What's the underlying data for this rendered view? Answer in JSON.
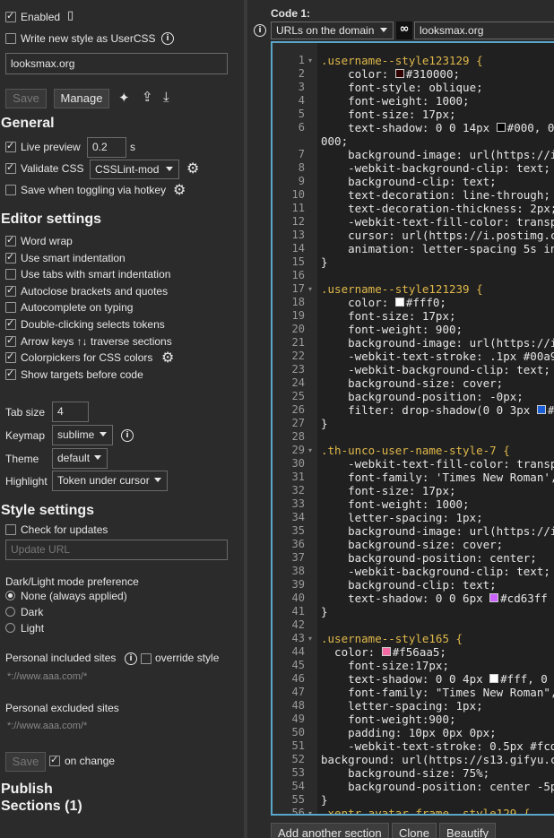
{
  "sidebar": {
    "enabled_label": "Enabled",
    "usercss_label": "Write new style as UserCSS",
    "name_value": "looksmax.org",
    "save_label": "Save",
    "manage_label": "Manage",
    "general_heading": "General",
    "live_preview_label": "Live preview",
    "live_preview_value": "0.2",
    "live_preview_unit": "s",
    "validate_css_label": "Validate CSS",
    "validate_css_value": "CSSLint-mod",
    "save_toggle_label": "Save when toggling via hotkey",
    "editor_heading": "Editor settings",
    "options": [
      {
        "label": "Word wrap",
        "checked": true
      },
      {
        "label": "Use smart indentation",
        "checked": true
      },
      {
        "label": "Use tabs with smart indentation",
        "checked": false
      },
      {
        "label": "Autoclose brackets and quotes",
        "checked": true
      },
      {
        "label": "Autocomplete on typing",
        "checked": false
      },
      {
        "label": "Double-clicking selects tokens",
        "checked": true
      },
      {
        "label": "Arrow keys ↑↓ traverse sections",
        "checked": true
      },
      {
        "label": "Colorpickers for CSS colors",
        "checked": true
      },
      {
        "label": "Show targets before code",
        "checked": true
      }
    ],
    "tab_size_label": "Tab size",
    "tab_size_value": "4",
    "keymap_label": "Keymap",
    "keymap_value": "sublime",
    "theme_label": "Theme",
    "theme_value": "default",
    "highlight_label": "Highlight",
    "highlight_value": "Token under cursor",
    "style_heading": "Style settings",
    "check_updates_label": "Check for updates",
    "update_url_placeholder": "Update URL",
    "mode_label": "Dark/Light mode preference",
    "mode_options": [
      "None (always applied)",
      "Dark",
      "Light"
    ],
    "included_label": "Personal included sites",
    "override_label": "override style",
    "included_placeholder": "*://www.aaa.com/*",
    "excluded_label": "Personal excluded sites",
    "excluded_placeholder": "*://www.aaa.com/*",
    "save2_label": "Save",
    "on_change_label": "on change",
    "publish_heading": "Publish",
    "sections_heading": "Sections (1)"
  },
  "main": {
    "code_label": "Code 1:",
    "applies_select": "URLs on the domain",
    "applies_value": "looksmax.org",
    "footer_buttons": [
      "Add another section",
      "Clone",
      "Beautify"
    ]
  },
  "editor": {
    "lines": [
      {
        "n": "1",
        "fold": true,
        "t": ".username--style123129 {"
      },
      {
        "n": "2",
        "t": "    color: #310000;"
      },
      {
        "n": "3",
        "t": "    font-style: oblique;"
      },
      {
        "n": "4",
        "t": "    font-weight: 1000;"
      },
      {
        "n": "5",
        "t": "    font-size: 17px;"
      },
      {
        "n": "6",
        "t": "    text-shadow: 0 0 14px #000, 0"
      },
      {
        "n": "",
        "t": "000;"
      },
      {
        "n": "7",
        "t": "    background-image: url(https://i"
      },
      {
        "n": "8",
        "t": "    -webkit-background-clip: text;"
      },
      {
        "n": "9",
        "t": "    background-clip: text;"
      },
      {
        "n": "10",
        "t": "    text-decoration: line-through;"
      },
      {
        "n": "11",
        "t": "    text-decoration-thickness: 2px;"
      },
      {
        "n": "12",
        "t": "    -webkit-text-fill-color: transp"
      },
      {
        "n": "13",
        "t": "    cursor: url(https://i.postimg.c"
      },
      {
        "n": "14",
        "t": "    animation: letter-spacing 5s in"
      },
      {
        "n": "15",
        "t": "}"
      },
      {
        "n": "16",
        "t": ""
      },
      {
        "n": "17",
        "fold": true,
        "t": ".username--style121239 {"
      },
      {
        "n": "18",
        "t": "    color: #fff0;"
      },
      {
        "n": "19",
        "t": "    font-size: 17px;"
      },
      {
        "n": "20",
        "t": "    font-weight: 900;"
      },
      {
        "n": "21",
        "t": "    background-image: url(https://i"
      },
      {
        "n": "22",
        "t": "    -webkit-text-stroke: .1px #00a9"
      },
      {
        "n": "23",
        "t": "    -webkit-background-clip: text;"
      },
      {
        "n": "24",
        "t": "    background-size: cover;"
      },
      {
        "n": "25",
        "t": "    background-position: -0px;"
      },
      {
        "n": "26",
        "t": "    filter: drop-shadow(0 0 3px #"
      },
      {
        "n": "27",
        "t": "}"
      },
      {
        "n": "28",
        "t": ""
      },
      {
        "n": "29",
        "fold": true,
        "t": ".th-unco-user-name-style-7 {"
      },
      {
        "n": "30",
        "t": "    -webkit-text-fill-color: transp"
      },
      {
        "n": "31",
        "t": "    font-family: 'Times New Roman',"
      },
      {
        "n": "32",
        "t": "    font-size: 17px;"
      },
      {
        "n": "33",
        "t": "    font-weight: 1000;"
      },
      {
        "n": "34",
        "t": "    letter-spacing: 1px;"
      },
      {
        "n": "35",
        "t": "    background-image: url(https://i"
      },
      {
        "n": "36",
        "t": "    background-size: cover;"
      },
      {
        "n": "37",
        "t": "    background-position: center;"
      },
      {
        "n": "38",
        "t": "    -webkit-background-clip: text;"
      },
      {
        "n": "39",
        "t": "    background-clip: text;"
      },
      {
        "n": "40",
        "t": "    text-shadow: 0 0 6px #cd63ff"
      },
      {
        "n": "41",
        "t": "}"
      },
      {
        "n": "42",
        "t": ""
      },
      {
        "n": "43",
        "fold": true,
        "t": ".username--style165 {"
      },
      {
        "n": "44",
        "t": "  color: #f56aa5;"
      },
      {
        "n": "45",
        "t": "    font-size:17px;"
      },
      {
        "n": "46",
        "t": "    text-shadow: 0 0 4px #fff, 0 0"
      },
      {
        "n": "47",
        "t": "    font-family: \"Times New Roman\","
      },
      {
        "n": "48",
        "t": "    letter-spacing: 1px;"
      },
      {
        "n": "49",
        "t": "    font-weight:900;"
      },
      {
        "n": "50",
        "t": "    padding: 10px 0px 0px;"
      },
      {
        "n": "51",
        "t": "    -webkit-text-stroke: 0.5px #fcd"
      },
      {
        "n": "52",
        "t": "background: url(https://s13.gifyu.c"
      },
      {
        "n": "53",
        "t": "    background-size: 75%;"
      },
      {
        "n": "54",
        "t": "    background-position: center -5p"
      },
      {
        "n": "55",
        "t": "}"
      },
      {
        "n": "56",
        "fold": true,
        "t": ".xentr-avatar-frame--style129 {"
      }
    ],
    "swatches": {
      "2": "#310000",
      "6": "#000000",
      "18": "#ffffff",
      "26": "#1a5fd8",
      "40": "#cd63ff",
      "44": "#f56aa5",
      "46": "#ffffff"
    }
  }
}
